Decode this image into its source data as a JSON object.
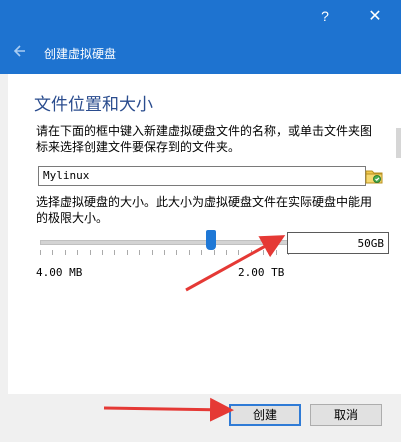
{
  "titlebar": {
    "help_icon_text": "?",
    "close_icon_text": "✕",
    "wizard_title": "创建虚拟硬盘"
  },
  "section": {
    "title": "文件位置和大小",
    "description_location": "请在下面的框中键入新建虚拟硬盘文件的名称，或单击文件夹图标来选择创建文件要保存到的文件夹。",
    "description_size": "选择虚拟硬盘的大小。此大小为虚拟硬盘文件在实际硬盘中能用的极限大小。"
  },
  "file": {
    "name_value": "Mylinux"
  },
  "size": {
    "value_text": "50GB",
    "min_label": "4.00 MB",
    "max_label": "2.00 TB",
    "slider_fraction": 0.69
  },
  "buttons": {
    "create_label": "创建",
    "cancel_label": "取消"
  },
  "colors": {
    "titlebar": "#1e73d0",
    "section_title": "#2a4c8e",
    "slider_thumb": "#1f78d6",
    "annotation_arrow": "#e53935"
  },
  "icons": {
    "back": "arrow-left-icon",
    "folder": "folder-icon",
    "help": "help-icon",
    "close": "close-icon"
  }
}
